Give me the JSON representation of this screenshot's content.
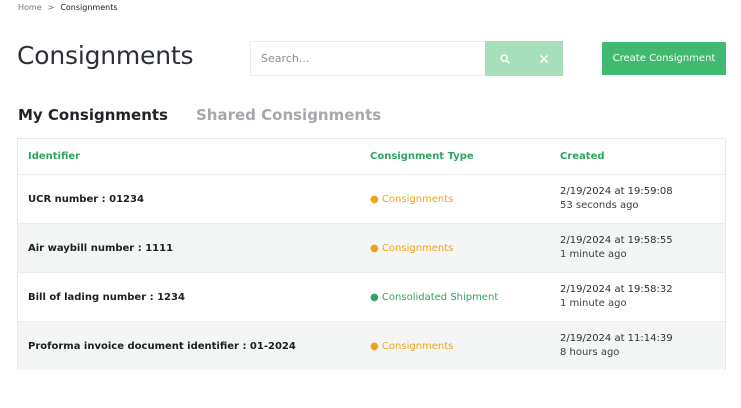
{
  "breadcrumb": {
    "home": "Home",
    "separator": ">",
    "current": "Consignments"
  },
  "page": {
    "title": "Consignments"
  },
  "search": {
    "placeholder": "Search...",
    "value": ""
  },
  "actions": {
    "create_label": "Create Consignment"
  },
  "tabs": [
    {
      "label": "My Consignments",
      "active": true
    },
    {
      "label": "Shared Consignments",
      "active": false
    }
  ],
  "table": {
    "columns": [
      "Identifier",
      "Consignment Type",
      "Created"
    ],
    "rows": [
      {
        "identifier": "UCR number : 01234",
        "type": "Consignments",
        "type_color": "#f0a31a",
        "created": "2/19/2024 at 19:59:08",
        "relative": "53 seconds ago"
      },
      {
        "identifier": "Air waybill number : 1111",
        "type": "Consignments",
        "type_color": "#f0a31a",
        "created": "2/19/2024 at 19:58:55",
        "relative": "1 minute ago"
      },
      {
        "identifier": "Bill of lading number : 1234",
        "type": "Consolidated Shipment",
        "type_color": "#2ea662",
        "created": "2/19/2024 at 19:58:32",
        "relative": "1 minute ago"
      },
      {
        "identifier": "Proforma invoice document identifier : 01-2024",
        "type": "Consignments",
        "type_color": "#f0a31a",
        "created": "2/19/2024 at 11:14:39",
        "relative": "8 hours ago"
      }
    ]
  },
  "icons": {
    "search": "search-icon",
    "clear": "close-icon"
  },
  "colors": {
    "accent": "#3fba6f",
    "accent_light": "#a7dfbd",
    "orange": "#f0a31a",
    "green": "#2ea662"
  },
  "bullet": "●"
}
